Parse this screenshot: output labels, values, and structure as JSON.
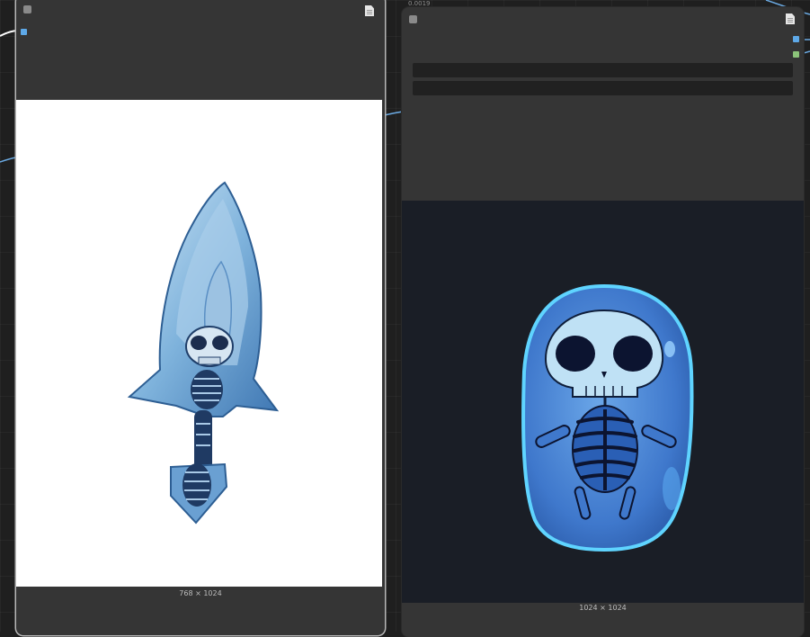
{
  "left_node": {
    "image_dimensions": "768 × 1024",
    "image_subject": "skeleton encased in blue ice shaped like a spearhead"
  },
  "right_node": {
    "image_dimensions": "1024 × 1024",
    "image_subject": "skull and skeleton inside a blue slime blob",
    "header_snippet": "0.0019"
  },
  "colors": {
    "canvas_bg": "#1f1f1f",
    "node_bg": "#353535",
    "wire": "#6aa8e0",
    "image_slot": "#5ea9e8",
    "mask_slot": "#8cc47a",
    "right_preview_bg": "#1a1e26"
  }
}
